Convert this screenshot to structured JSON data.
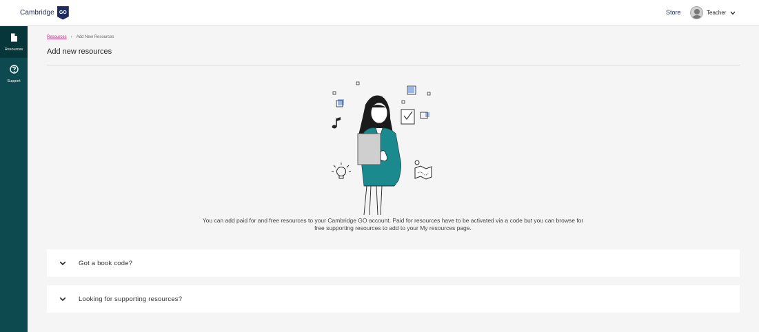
{
  "header": {
    "logo_text": "Cambridge",
    "logo_badge": "GO",
    "store_label": "Store",
    "user_name": "Teacher"
  },
  "sidebar": {
    "items": [
      {
        "label": "Resources",
        "icon": "document-icon",
        "active": true
      },
      {
        "label": "Support",
        "icon": "help-circle-icon",
        "active": false
      }
    ]
  },
  "breadcrumb": {
    "items": [
      "Resources",
      "Add New Resources"
    ],
    "separator": "›"
  },
  "page": {
    "title": "Add new resources",
    "intro_line1": "You can add paid for and free resources to your Cambridge GO account. Paid for resources have to be activated via a code but you can browse for",
    "intro_line2": "free supporting resources to add to your My resources page."
  },
  "accordions": [
    {
      "label": "Got a book code?"
    },
    {
      "label": "Looking for supporting resources?"
    }
  ],
  "colors": {
    "sidebar_bg": "#0c4a4f",
    "sidebar_active": "#06353a",
    "brand_navy": "#1e2d5e",
    "link_pink": "#c2337a",
    "illustration_teal": "#1a8a8f",
    "illustration_blue": "#5b8fe0"
  }
}
